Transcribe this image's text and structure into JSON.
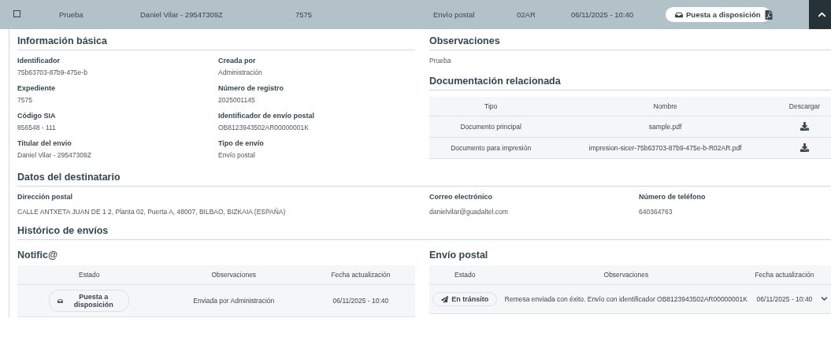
{
  "row": {
    "checked": false,
    "expanded": true,
    "cells": [
      "Prueba",
      "Daniel Vilar - 29547309Z",
      "7575",
      "Envío postal",
      "02AR",
      "06/11/2025 - 10:40"
    ],
    "status": "Puesta a disposición"
  },
  "basic_info": {
    "title": "Información básica",
    "fields": [
      {
        "label": "Identificador",
        "value": "75b63703-87b9-475e-b"
      },
      {
        "label": "Creada por",
        "value": "Administración"
      },
      {
        "label": "Expediente",
        "value": "7575"
      },
      {
        "label": "Número de registro",
        "value": "2025001145"
      },
      {
        "label": "Código SIA",
        "value": "856548 - 111"
      },
      {
        "label": "Identificador de envío postal",
        "value": "OB8123943502AR00000001K"
      },
      {
        "label": "Titular del envio",
        "value": "Daniel Vilar - 29547309Z"
      },
      {
        "label": "Tipo de envío",
        "value": "Envío postal"
      }
    ]
  },
  "observations": {
    "title": "Observaciones",
    "text": "Prueba"
  },
  "documents": {
    "title": "Documentación relacionada",
    "columns": [
      "Tipo",
      "Nombre",
      "Descargar"
    ],
    "rows": [
      {
        "type": "Documento principal",
        "name": "sample.pdf"
      },
      {
        "type": "Documento para impresión",
        "name": "impresion-sicer-75b63703-87b9-475e-b-R02AR.pdf"
      }
    ]
  },
  "recipient": {
    "title": "Datos del destinatario",
    "fields": [
      {
        "label": "Dirección postal",
        "value": "CALLE ANTXETA JUAN DE 1 2, Planta 02, Puerta A, 48007, BILBAO, BIZKAIA (ESPAÑA)"
      },
      {
        "label": "Correo electrónico",
        "value": "danielvilar@guadaltel.com"
      },
      {
        "label": "Número de teléfono",
        "value": "640364763"
      }
    ]
  },
  "history": {
    "title": "Histórico de envíos",
    "panels": [
      {
        "title": "Notific@",
        "columns": [
          "Estado",
          "Observaciones",
          "Fecha actualización"
        ],
        "rows": [
          {
            "status": "Puesta a disposición",
            "kind": "available",
            "observations": "Enviada por Administración",
            "date": "06/11/2025 - 10:40",
            "expandable": false
          }
        ]
      },
      {
        "title": "Envío postal",
        "columns": [
          "Estado",
          "Observaciones",
          "Fecha actualización"
        ],
        "rows": [
          {
            "status": "En tránsito",
            "kind": "transit",
            "observations": "Remesa enviada con éxito. Envío con identificador OB8123943502AR00000001K",
            "date": "06/11/2025 - 10:40",
            "expandable": true
          }
        ]
      }
    ]
  }
}
